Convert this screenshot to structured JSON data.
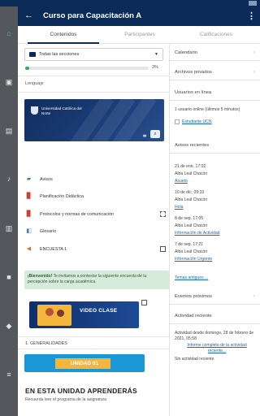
{
  "app": {
    "title": "Curso para Capacitación A",
    "back_icon": "arrow-left-icon",
    "menu_icon": "kebab-menu-icon",
    "colors": {
      "appbar": "#0a2a57",
      "rail": "#54575c",
      "rail_active": "#27c3ee",
      "progress": "#2fb05e",
      "notice_bg": "#d7ebdb",
      "link": "#1a6aa8"
    }
  },
  "rail": {
    "items": [
      "home-icon",
      "calendar-icon",
      "messages-icon",
      "notifications-icon",
      "grades-icon",
      "files-icon",
      "tag-icon",
      "menu-icon"
    ]
  },
  "tabs": [
    "Contenidos",
    "Participantes",
    "Calificaciones"
  ],
  "main": {
    "section_select": "Todas las secciones",
    "progress_value": 3,
    "progress_text": "3%",
    "lenguaje_label": "Lenguaje",
    "banner": {
      "university": "Universidad Católica del Norte"
    },
    "activities": [
      {
        "label": "Avisos",
        "icon": "forum-icon"
      },
      {
        "label": "Planificación Didáctica",
        "icon": "pdf-file-icon"
      },
      {
        "label": "Protocolos y normas de comunicación",
        "icon": "pdf-file-icon"
      },
      {
        "label": "Glosario",
        "icon": "glossary-icon"
      },
      {
        "label": "ENCUESTA 1",
        "icon": "survey-icon"
      }
    ],
    "notice": {
      "strong": "¡Bienvenido!",
      "text": " Te invitamos a contestar la siguiente encuesta de tu percepción sobre la carga académica."
    },
    "video": {
      "title": "VIDEO CLASE"
    },
    "generalidades": "1. GENERALIDADES",
    "unidad_banner": "UNIDAD 01",
    "unit_heading": "EN ESTA UNIDAD APRENDERÁS",
    "unit_sub": "Recuerda leer el programa de la asignatura"
  },
  "aside": {
    "calendario": "Calendario",
    "archivos": "Archivos privados",
    "usuarios": {
      "title": "Usuarios en línea",
      "summary": "1 usuario online (últimos 5 minutos)",
      "user": "Estudiante UCN"
    },
    "avisos": {
      "title": "Avisos recientes",
      "items": [
        {
          "date": "21 de ene, 17:02",
          "author": "Alba Leal Chacón",
          "link": "Asueto"
        },
        {
          "date": "10 de dic, 09:33",
          "author": "Alba Leal Chacón",
          "link": "Hola"
        },
        {
          "date": "8 de sep, 17:05",
          "author": "Alba Leal Chacón",
          "link": "Información de Actividad"
        },
        {
          "date": "7 de sep, 17:21",
          "author": "Alba Leal Chacón",
          "link": "Información Urgente"
        }
      ],
      "more": "Temas antiguos ..."
    },
    "eventos": "Eventos próximos",
    "actividad": {
      "title": "Actividad reciente",
      "since": "Actividad desde domingo, 28 de febrero de 2021, 05:58",
      "report_link": "Informe completo de la actividad reciente...",
      "none": "Sin actividad reciente"
    }
  }
}
